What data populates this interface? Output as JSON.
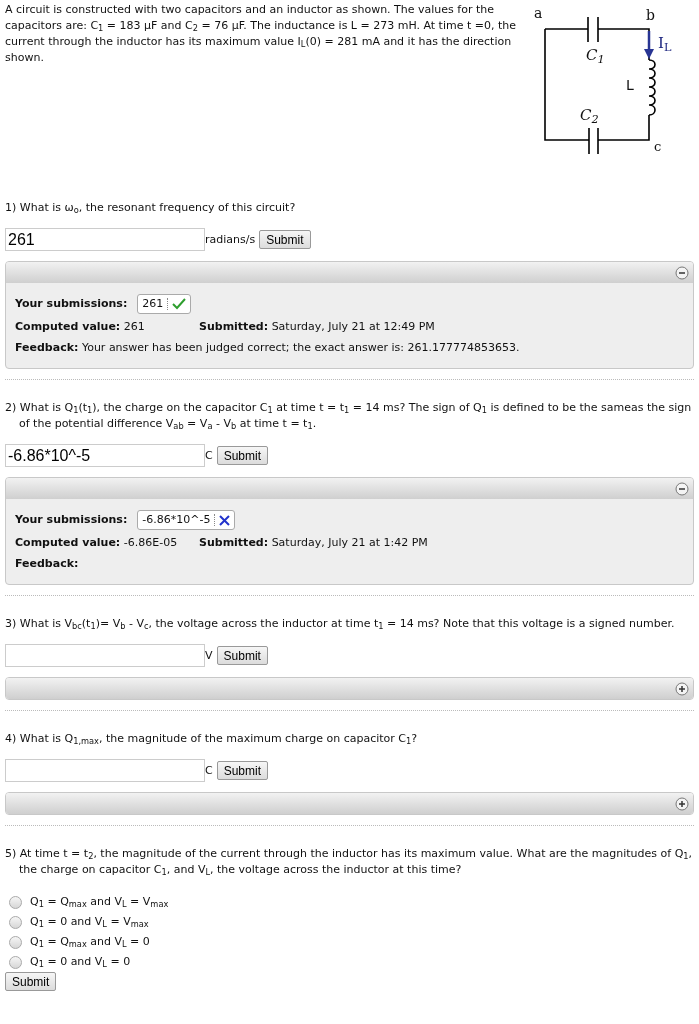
{
  "intro": "A circuit is constructed with two capacitors and an inductor as shown. The values for the capacitors are: C$_{1}$ = 183 μF and C$_{2}$ = 76 μF. The inductance is L = 273 mH. At time t =0, the current through the inductor has its maximum value I$_{L}$(0) = 281 mA and it has the direction shown.",
  "circuit": {
    "labels": [
      {
        "kind": "a",
        "text": "a"
      },
      {
        "kind": "b",
        "text": "b"
      },
      {
        "kind": "c",
        "text": "c"
      },
      {
        "kind": "c1",
        "text": "C$_{1}$"
      },
      {
        "kind": "c2",
        "text": "C$_{2}$"
      },
      {
        "kind": "l",
        "text": "L"
      },
      {
        "kind": "il",
        "text": "I$_{L}$"
      }
    ]
  },
  "questions": [
    {
      "kind": "numeric",
      "prompt": "1) What is ω$_{o}$, the resonant frequency of this circuit?",
      "value": "261",
      "unit": "radians/s",
      "submit": "Submit",
      "panel": {
        "expanded": true,
        "submissions": [
          {
            "value": "261",
            "correct": true
          }
        ],
        "submissions_label": "Your submissions:",
        "computed_label": "Computed value:",
        "computed_value": "261",
        "submitted_label": "Submitted:",
        "submitted_value": "Saturday, July 21 at 12:49 PM",
        "feedback_label": "Feedback:",
        "feedback_text": "Your answer has been judged correct; the exact answer is: 261.177774853653."
      }
    },
    {
      "kind": "numeric",
      "prompt": "2) What is Q$_{1}$(t$_{1}$), the charge on the capacitor C$_{1}$ at time t = t$_{1}$ = 14 ms? The sign of Q$_{1}$ is defined to be the sameas the sign of the potential difference V$_{ab}$ = V$_{a}$ - V$_{b}$ at time t = t$_{1}$.",
      "value": "-6.86*10^-5",
      "unit": "C",
      "submit": "Submit",
      "panel": {
        "expanded": true,
        "submissions": [
          {
            "value": "-6.86*10^-5",
            "correct": false
          }
        ],
        "submissions_label": "Your submissions:",
        "computed_label": "Computed value:",
        "computed_value": "-6.86E-05",
        "submitted_label": "Submitted:",
        "submitted_value": "Saturday, July 21 at 1:42 PM",
        "feedback_label": "Feedback:"
      }
    },
    {
      "kind": "numeric",
      "prompt": "3) What is V$_{bc}$(t$_{1}$)= V$_{b}$ - V$_{c}$, the voltage across the inductor at time t$_{1}$ = 14 ms? Note that this voltage is a signed number.",
      "unit": "V",
      "submit": "Submit",
      "panel": {
        "expanded": false
      }
    },
    {
      "kind": "numeric",
      "prompt": "4) What is Q$_{1,max}$, the magnitude of the maximum charge on capacitor C$_{1}$?",
      "unit": "C",
      "submit": "Submit",
      "panel": {
        "expanded": false
      }
    },
    {
      "kind": "choice",
      "prompt": "5) At time t = t$_{2}$, the magnitude of the current through the inductor has its maximum value. What are the magnitudes of Q$_{1}$, the charge on capacitor C$_{1}$, and V$_{L}$, the voltage across the inductor at this time?",
      "options": [
        {
          "label": "Q$_{1}$ = Q$_{max}$ and V$_{L}$ = V$_{max}$",
          "selected": false
        },
        {
          "label": "Q$_{1}$ = 0 and V$_{L}$ = V$_{max}$",
          "selected": false
        },
        {
          "label": "Q$_{1}$ = Q$_{max}$ and V$_{L}$ = 0",
          "selected": false
        },
        {
          "label": "Q$_{1}$ = 0 and V$_{L}$ = 0",
          "selected": false
        }
      ],
      "submit": "Submit"
    }
  ]
}
